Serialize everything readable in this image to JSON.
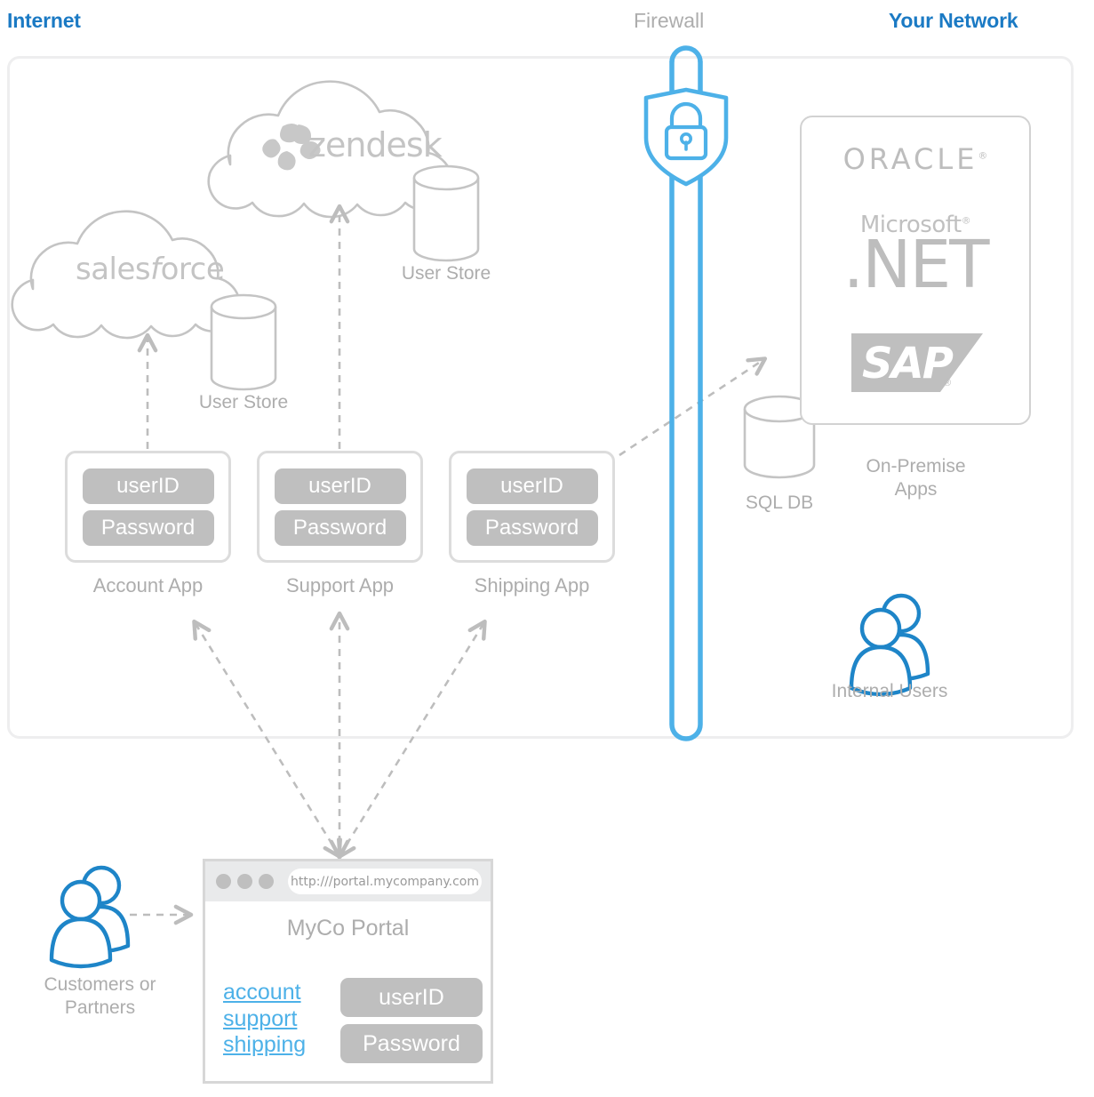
{
  "zones": {
    "internet_label": "Internet",
    "firewall_label": "Firewall",
    "your_network_label": "Your Network"
  },
  "colors": {
    "heading_blue": "#1b7ac4",
    "accent_blue": "#4db1e8",
    "grey_line": "#c4c4c4",
    "grey_text": "#adadad",
    "pill_grey": "#bfbfbf",
    "panel_border": "#eeeeef"
  },
  "clouds": [
    {
      "id": "salesforce",
      "logo": "salesforce",
      "logo_prefix": "sales",
      "logo_italic": "f",
      "logo_suffix": "orce"
    },
    {
      "id": "zendesk",
      "logo": "zendesk"
    }
  ],
  "datastores": [
    {
      "id": "salesforce-user-store",
      "label": "User Store"
    },
    {
      "id": "zendesk-user-store",
      "label": "User Store"
    },
    {
      "id": "sql-db",
      "label": "SQL DB"
    }
  ],
  "apps": [
    {
      "id": "account-app",
      "caption": "Account App",
      "fields": [
        "userID",
        "Password"
      ]
    },
    {
      "id": "support-app",
      "caption": "Support App",
      "fields": [
        "userID",
        "Password"
      ]
    },
    {
      "id": "shipping-app",
      "caption": "Shipping App",
      "fields": [
        "userID",
        "Password"
      ]
    }
  ],
  "on_premise": {
    "caption_line1": "On-Premise",
    "caption_line2": "Apps",
    "logos": {
      "oracle": "ORACLE",
      "oracle_mark": "®",
      "microsoft": "Microsoft",
      "microsoft_mark": "®",
      "dotnet": ".NET",
      "sap": "SAP",
      "sap_mark": "®"
    }
  },
  "internal_users": {
    "label": "Internal Users"
  },
  "external_users": {
    "line1": "Customers or",
    "line2": "Partners"
  },
  "portal": {
    "url": "http:///portal.mycompany.com",
    "title": "MyCo Portal",
    "links": [
      "account",
      "support",
      "shipping"
    ],
    "fields": [
      "userID",
      "Password"
    ]
  },
  "icons": {
    "firewall": "shield-lock-icon",
    "users": "users-icon",
    "cloud": "cloud-icon",
    "database": "database-cylinder-icon"
  }
}
